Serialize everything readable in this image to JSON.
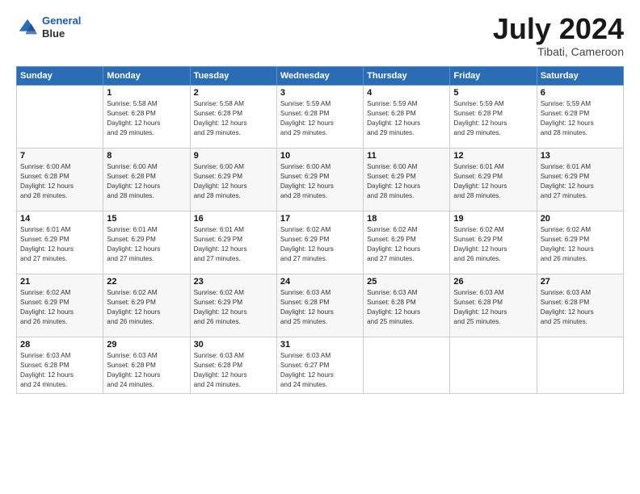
{
  "logo": {
    "line1": "General",
    "line2": "Blue"
  },
  "title": {
    "month_year": "July 2024",
    "location": "Tibati, Cameroon"
  },
  "days_of_week": [
    "Sunday",
    "Monday",
    "Tuesday",
    "Wednesday",
    "Thursday",
    "Friday",
    "Saturday"
  ],
  "weeks": [
    [
      {
        "day": "",
        "info": ""
      },
      {
        "day": "1",
        "info": "Sunrise: 5:58 AM\nSunset: 6:28 PM\nDaylight: 12 hours\nand 29 minutes."
      },
      {
        "day": "2",
        "info": "Sunrise: 5:58 AM\nSunset: 6:28 PM\nDaylight: 12 hours\nand 29 minutes."
      },
      {
        "day": "3",
        "info": "Sunrise: 5:59 AM\nSunset: 6:28 PM\nDaylight: 12 hours\nand 29 minutes."
      },
      {
        "day": "4",
        "info": "Sunrise: 5:59 AM\nSunset: 6:28 PM\nDaylight: 12 hours\nand 29 minutes."
      },
      {
        "day": "5",
        "info": "Sunrise: 5:59 AM\nSunset: 6:28 PM\nDaylight: 12 hours\nand 29 minutes."
      },
      {
        "day": "6",
        "info": "Sunrise: 5:59 AM\nSunset: 6:28 PM\nDaylight: 12 hours\nand 28 minutes."
      }
    ],
    [
      {
        "day": "7",
        "info": "Sunrise: 6:00 AM\nSunset: 6:28 PM\nDaylight: 12 hours\nand 28 minutes."
      },
      {
        "day": "8",
        "info": "Sunrise: 6:00 AM\nSunset: 6:28 PM\nDaylight: 12 hours\nand 28 minutes."
      },
      {
        "day": "9",
        "info": "Sunrise: 6:00 AM\nSunset: 6:29 PM\nDaylight: 12 hours\nand 28 minutes."
      },
      {
        "day": "10",
        "info": "Sunrise: 6:00 AM\nSunset: 6:29 PM\nDaylight: 12 hours\nand 28 minutes."
      },
      {
        "day": "11",
        "info": "Sunrise: 6:00 AM\nSunset: 6:29 PM\nDaylight: 12 hours\nand 28 minutes."
      },
      {
        "day": "12",
        "info": "Sunrise: 6:01 AM\nSunset: 6:29 PM\nDaylight: 12 hours\nand 28 minutes."
      },
      {
        "day": "13",
        "info": "Sunrise: 6:01 AM\nSunset: 6:29 PM\nDaylight: 12 hours\nand 27 minutes."
      }
    ],
    [
      {
        "day": "14",
        "info": "Sunrise: 6:01 AM\nSunset: 6:29 PM\nDaylight: 12 hours\nand 27 minutes."
      },
      {
        "day": "15",
        "info": "Sunrise: 6:01 AM\nSunset: 6:29 PM\nDaylight: 12 hours\nand 27 minutes."
      },
      {
        "day": "16",
        "info": "Sunrise: 6:01 AM\nSunset: 6:29 PM\nDaylight: 12 hours\nand 27 minutes."
      },
      {
        "day": "17",
        "info": "Sunrise: 6:02 AM\nSunset: 6:29 PM\nDaylight: 12 hours\nand 27 minutes."
      },
      {
        "day": "18",
        "info": "Sunrise: 6:02 AM\nSunset: 6:29 PM\nDaylight: 12 hours\nand 27 minutes."
      },
      {
        "day": "19",
        "info": "Sunrise: 6:02 AM\nSunset: 6:29 PM\nDaylight: 12 hours\nand 26 minutes."
      },
      {
        "day": "20",
        "info": "Sunrise: 6:02 AM\nSunset: 6:29 PM\nDaylight: 12 hours\nand 26 minutes."
      }
    ],
    [
      {
        "day": "21",
        "info": "Sunrise: 6:02 AM\nSunset: 6:29 PM\nDaylight: 12 hours\nand 26 minutes."
      },
      {
        "day": "22",
        "info": "Sunrise: 6:02 AM\nSunset: 6:29 PM\nDaylight: 12 hours\nand 26 minutes."
      },
      {
        "day": "23",
        "info": "Sunrise: 6:02 AM\nSunset: 6:29 PM\nDaylight: 12 hours\nand 26 minutes."
      },
      {
        "day": "24",
        "info": "Sunrise: 6:03 AM\nSunset: 6:28 PM\nDaylight: 12 hours\nand 25 minutes."
      },
      {
        "day": "25",
        "info": "Sunrise: 6:03 AM\nSunset: 6:28 PM\nDaylight: 12 hours\nand 25 minutes."
      },
      {
        "day": "26",
        "info": "Sunrise: 6:03 AM\nSunset: 6:28 PM\nDaylight: 12 hours\nand 25 minutes."
      },
      {
        "day": "27",
        "info": "Sunrise: 6:03 AM\nSunset: 6:28 PM\nDaylight: 12 hours\nand 25 minutes."
      }
    ],
    [
      {
        "day": "28",
        "info": "Sunrise: 6:03 AM\nSunset: 6:28 PM\nDaylight: 12 hours\nand 24 minutes."
      },
      {
        "day": "29",
        "info": "Sunrise: 6:03 AM\nSunset: 6:28 PM\nDaylight: 12 hours\nand 24 minutes."
      },
      {
        "day": "30",
        "info": "Sunrise: 6:03 AM\nSunset: 6:28 PM\nDaylight: 12 hours\nand 24 minutes."
      },
      {
        "day": "31",
        "info": "Sunrise: 6:03 AM\nSunset: 6:27 PM\nDaylight: 12 hours\nand 24 minutes."
      },
      {
        "day": "",
        "info": ""
      },
      {
        "day": "",
        "info": ""
      },
      {
        "day": "",
        "info": ""
      }
    ]
  ]
}
